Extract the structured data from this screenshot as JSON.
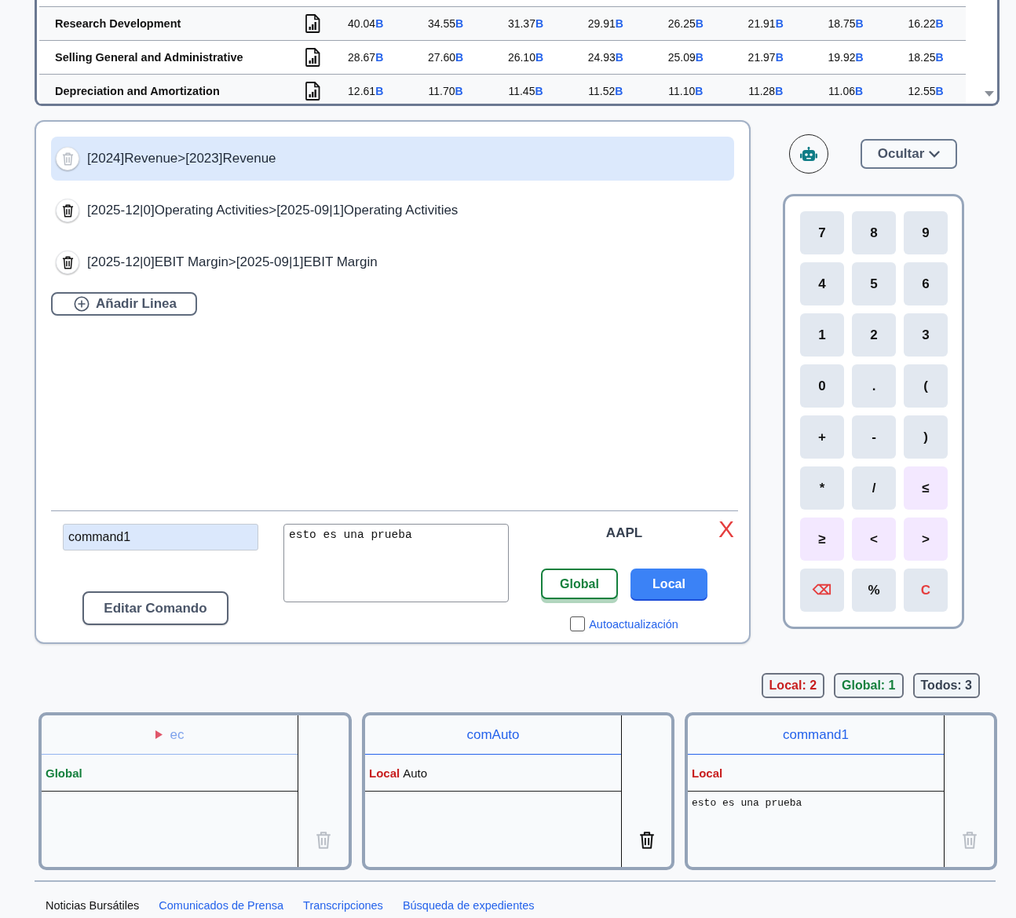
{
  "financials_table": {
    "rows": [
      {
        "label": "Research Development",
        "values": [
          {
            "amount": "40.04",
            "unit": "B"
          },
          {
            "amount": "34.55",
            "unit": "B"
          },
          {
            "amount": "31.37",
            "unit": "B"
          },
          {
            "amount": "29.91",
            "unit": "B"
          },
          {
            "amount": "26.25",
            "unit": "B"
          },
          {
            "amount": "21.91",
            "unit": "B"
          },
          {
            "amount": "18.75",
            "unit": "B"
          },
          {
            "amount": "16.22",
            "unit": "B"
          }
        ]
      },
      {
        "label": "Selling General and Administrative",
        "values": [
          {
            "amount": "28.67",
            "unit": "B"
          },
          {
            "amount": "27.60",
            "unit": "B"
          },
          {
            "amount": "26.10",
            "unit": "B"
          },
          {
            "amount": "24.93",
            "unit": "B"
          },
          {
            "amount": "25.09",
            "unit": "B"
          },
          {
            "amount": "21.97",
            "unit": "B"
          },
          {
            "amount": "19.92",
            "unit": "B"
          },
          {
            "amount": "18.25",
            "unit": "B"
          }
        ]
      },
      {
        "label": "Depreciation and Amortization",
        "values": [
          {
            "amount": "12.61",
            "unit": "B"
          },
          {
            "amount": "11.70",
            "unit": "B"
          },
          {
            "amount": "11.45",
            "unit": "B"
          },
          {
            "amount": "11.52",
            "unit": "B"
          },
          {
            "amount": "11.10",
            "unit": "B"
          },
          {
            "amount": "11.28",
            "unit": "B"
          },
          {
            "amount": "11.06",
            "unit": "B"
          },
          {
            "amount": "12.55",
            "unit": "B"
          }
        ]
      }
    ]
  },
  "formula_editor": {
    "lines": [
      {
        "text": "[2024]Revenue>[2023]Revenue",
        "selected": true
      },
      {
        "text": "[2025-12|0]Operating Activities>[2025-09|1]Operating Activities",
        "selected": false
      },
      {
        "text": "[2025-12|0]EBIT Margin>[2025-09|1]EBIT Margin",
        "selected": false
      }
    ],
    "add_line_button": "Añadir Linea",
    "command_name": {
      "value": "command1"
    },
    "description": {
      "value": "esto es una prueba"
    },
    "edit_button": "Editar Comando",
    "ticker": "AAPL",
    "close_button": "X",
    "scope_buttons": [
      {
        "label": "Global",
        "selected": false,
        "color": "#15803d"
      },
      {
        "label": "Local",
        "selected": true,
        "color": "#3b82f6"
      }
    ],
    "auto_update": {
      "label": "Autoactualización",
      "checked": false
    }
  },
  "hide_button": "Ocultar",
  "keypad": {
    "keys": [
      {
        "label": "7",
        "kind": "key"
      },
      {
        "label": "8",
        "kind": "key"
      },
      {
        "label": "9",
        "kind": "key"
      },
      {
        "label": "4",
        "kind": "key"
      },
      {
        "label": "5",
        "kind": "key"
      },
      {
        "label": "6",
        "kind": "key"
      },
      {
        "label": "1",
        "kind": "key"
      },
      {
        "label": "2",
        "kind": "key"
      },
      {
        "label": "3",
        "kind": "key"
      },
      {
        "label": "0",
        "kind": "key"
      },
      {
        "label": ".",
        "kind": "key"
      },
      {
        "label": "(",
        "kind": "key"
      },
      {
        "label": "+",
        "kind": "key"
      },
      {
        "label": "-",
        "kind": "key"
      },
      {
        "label": ")",
        "kind": "key"
      },
      {
        "label": "*",
        "kind": "key"
      },
      {
        "label": "/",
        "kind": "key"
      },
      {
        "label": "≤",
        "kind": "compare"
      },
      {
        "label": "≥",
        "kind": "compare"
      },
      {
        "label": "<",
        "kind": "compare"
      },
      {
        "label": ">",
        "kind": "compare"
      },
      {
        "label": "⌫",
        "kind": "danger"
      },
      {
        "label": "%",
        "kind": "key"
      },
      {
        "label": "C",
        "kind": "danger"
      }
    ]
  },
  "filters": [
    {
      "label": "Local: 2",
      "color": "#c81e1e"
    },
    {
      "label": "Global: 1",
      "color": "#15803d"
    },
    {
      "label": "Todos: 3",
      "color": "#374151"
    }
  ],
  "commands": [
    {
      "title": "ec",
      "running": true,
      "scope": {
        "label": "Global",
        "color": "#15803d"
      },
      "delete_disabled": true
    },
    {
      "title": "comAuto",
      "running": false,
      "scope": {
        "label": "Local",
        "color": "#c81e1e"
      },
      "tag": "Auto",
      "delete_disabled": false
    },
    {
      "title": "command1",
      "running": false,
      "scope": {
        "label": "Local",
        "color": "#c81e1e"
      },
      "body": "esto es una prueba",
      "delete_disabled": true
    }
  ],
  "footer_tabs": [
    {
      "label": "Noticias Bursátiles",
      "selected": true
    },
    {
      "label": "Comunicados de Prensa",
      "selected": false
    },
    {
      "label": "Transcripciones",
      "selected": false
    },
    {
      "label": "Búsqueda de expedientes",
      "selected": false
    }
  ]
}
